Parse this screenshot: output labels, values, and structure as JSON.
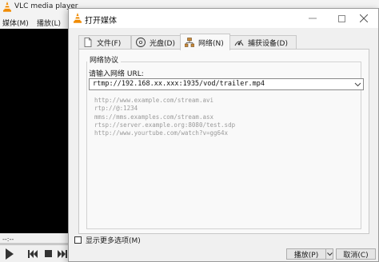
{
  "vlc": {
    "title": "VLC media player",
    "menus": [
      "媒体(M)",
      "播放(L)"
    ],
    "time": "--:--"
  },
  "dialog": {
    "title": "打开媒体",
    "tabs": [
      {
        "label": "文件(F)",
        "icon": "file-icon"
      },
      {
        "label": "光盘(D)",
        "icon": "disc-icon"
      },
      {
        "label": "网络(N)",
        "icon": "network-icon"
      },
      {
        "label": "捕获设备(D)",
        "icon": "capture-device-icon"
      }
    ],
    "active_tab": "网络(N)",
    "group_title": "网络协议",
    "url_label": "请输入网络 URL:",
    "url_value": "rtmp://192.168.xx.xxx:1935/vod/trailer.mp4",
    "examples": [
      "http://www.example.com/stream.avi",
      "rtp://@:1234",
      "mms://mms.examples.com/stream.asx",
      "rtsp://server.example.org:8080/test.sdp",
      "http://www.yourtube.com/watch?v=gg64x"
    ],
    "show_more_options_label": "显示更多选项(M)",
    "show_more_options_checked": false,
    "play_label": "播放(P)",
    "cancel_label": "取消(C)"
  },
  "colors": {
    "vlc_orange": "#f08a00",
    "video_bg": "#000000",
    "dialog_bg": "#f0f0f0",
    "example_text": "#9a9a9a"
  }
}
